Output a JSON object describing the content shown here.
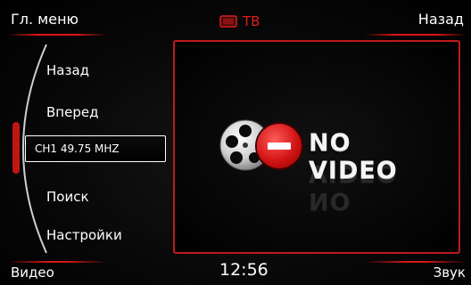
{
  "header": {
    "main_menu": "Гл. меню",
    "title": "ТВ",
    "back": "Назад",
    "title_icon": "tv-icon"
  },
  "menu": {
    "back": "Назад",
    "forward": "Вперед",
    "channel": "CH1 49.75 MHZ",
    "search": "Поиск",
    "settings": "Настройки"
  },
  "video": {
    "status": "NO VIDEO",
    "icon": "film-reel-stop-icon"
  },
  "footer": {
    "source": "Видео",
    "time": "12:56",
    "sound": "Звук"
  },
  "colors": {
    "accent": "#e21c1c",
    "background": "#000000",
    "text": "#ffffff"
  }
}
